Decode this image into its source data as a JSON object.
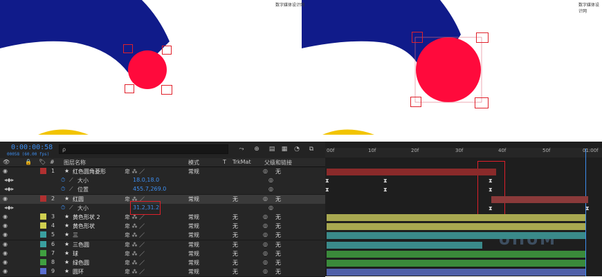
{
  "watermark": "数字媒体设计网",
  "timeline": {
    "timecode": "0:00:00:58",
    "fps": "00058 (60.00 fps)",
    "search_placeholder": "ρ",
    "headers": {
      "label_col": "#",
      "layer_name": "图层名称",
      "mode": "模式",
      "t": "T",
      "trkmat": "TrkMat",
      "parent": "父级和链接"
    },
    "ruler_ticks": [
      "00f",
      "10f",
      "20f",
      "30f",
      "40f",
      "50f",
      "01:00f"
    ],
    "layers": [
      {
        "num": "1",
        "name": "红色圆角菱形",
        "mode": "常规",
        "trkmat": "",
        "parent": "无",
        "color": "#b03030"
      },
      {
        "num": "",
        "name": "大小",
        "value": "18.0,18.0",
        "prop": true
      },
      {
        "num": "",
        "name": "位置",
        "value": "455.7,269.0",
        "prop": true
      },
      {
        "num": "2",
        "name": "红圆",
        "mode": "常规",
        "trkmat": "无",
        "parent": "无",
        "color": "#b03030"
      },
      {
        "num": "",
        "name": "大小",
        "value": "31.2,31.2",
        "prop": true
      },
      {
        "num": "3",
        "name": "黄色形状 2",
        "mode": "常规",
        "trkmat": "无",
        "parent": "无",
        "color": "#cfcf50"
      },
      {
        "num": "4",
        "name": "黄色形状",
        "mode": "常规",
        "trkmat": "无",
        "parent": "无",
        "color": "#cfcf50"
      },
      {
        "num": "5",
        "name": "三",
        "mode": "常规",
        "trkmat": "无",
        "parent": "无",
        "color": "#3aa0a0"
      },
      {
        "num": "6",
        "name": "三色圆",
        "mode": "常规",
        "trkmat": "无",
        "parent": "无",
        "color": "#3aa0a0"
      },
      {
        "num": "7",
        "name": "球",
        "mode": "常规",
        "trkmat": "无",
        "parent": "无",
        "color": "#40a040"
      },
      {
        "num": "8",
        "name": "绿色圆",
        "mode": "常规",
        "trkmat": "无",
        "parent": "无",
        "color": "#40a040"
      },
      {
        "num": "9",
        "name": "圆环",
        "mode": "常规",
        "trkmat": "无",
        "parent": "无",
        "color": "#5a6fd0"
      }
    ]
  },
  "brand": "UIIUM",
  "colors": {
    "accent": "#3d8ef0",
    "highlight": "#e0202a",
    "navy": "#101b8a",
    "red": "#ff0a3c",
    "yellow": "#f2c400"
  }
}
